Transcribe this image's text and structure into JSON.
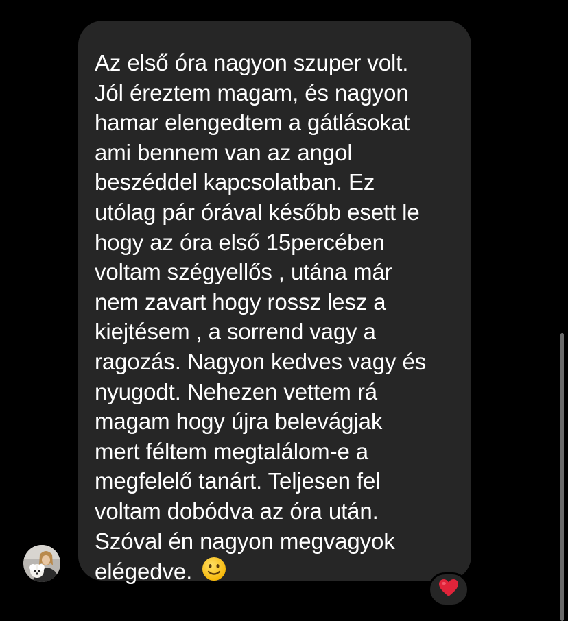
{
  "message": {
    "lines": [
      "Az első óra nagyon szuper volt.",
      "Jól éreztem magam, és nagyon",
      "hamar elengedtem a gátlásokat",
      "ami bennem van az angol",
      "beszéddel kapcsolatban. Ez",
      "utólag pár órával később esett le",
      "hogy az óra első 15percében",
      "voltam szégyellős , utána már",
      "nem zavart hogy rossz lesz a",
      "kiejtésem , a sorrend vagy a",
      "ragozás. Nagyon kedves vagy és",
      "nyugodt. Nehezen vettem rá",
      "magam hogy újra belevágjak",
      "mert féltem megtalálom-e a",
      "megfelelő tanárt. Teljesen fel",
      "voltam dobódva az óra után.",
      "Szóval én nagyon megvagyok",
      "elégedve."
    ],
    "emoji_icon": "slightly-smiling-face-icon"
  },
  "reaction": {
    "icon": "red-heart-icon",
    "color": "#e0243a"
  },
  "colors": {
    "background": "#000000",
    "bubble": "#262626",
    "text": "#ffffff"
  }
}
